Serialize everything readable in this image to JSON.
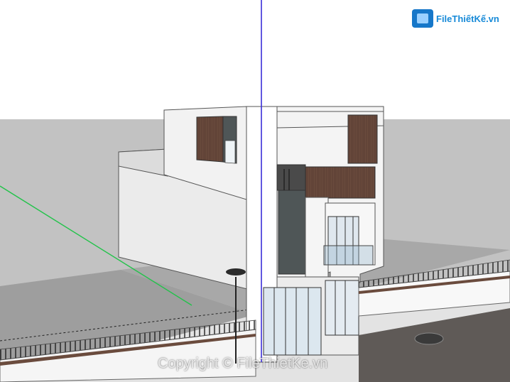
{
  "branding": {
    "logo_text": "FileThiếtKế.vn",
    "watermark_text": "Copyright © FileThietKe.vn"
  },
  "scene": {
    "view": "3D model viewport",
    "subject": "townhouse facade with fence and street lamp"
  },
  "colors": {
    "sky": "#ffffff",
    "ground": "#bfbfbf",
    "road": "#d9d9d9",
    "wall": "#f2f2f2",
    "wood": "#6a4b3d",
    "dark": "#4f5657",
    "glass": "#8fb2c8",
    "blue_axis": "#3b2fd8",
    "green_axis": "#22c34a",
    "logo_blue": "#178ad8"
  }
}
